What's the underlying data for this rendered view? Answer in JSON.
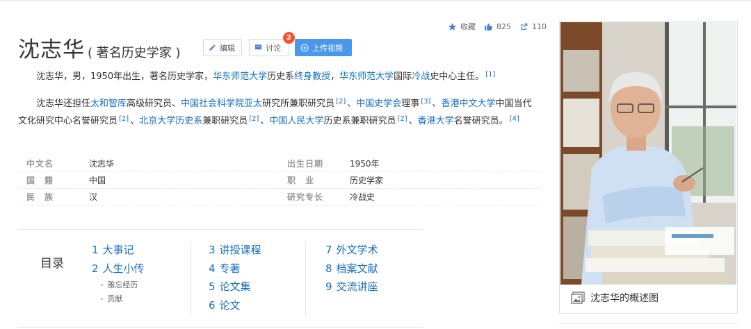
{
  "actions": {
    "favorite_label": "收藏",
    "like_count": "825",
    "share_count": "110"
  },
  "header": {
    "title": "沈志华",
    "subtitle": "( 著名历史学家 )",
    "edit_label": "编辑",
    "discuss_label": "讨论",
    "discuss_badge": "2",
    "upload_label": "上传视频"
  },
  "summary": {
    "p1": {
      "a": "沈志华，男，1950年出生，著名历史学家，",
      "link1": "华东师范大学",
      "b": "历史系",
      "link2": "终身教授",
      "c": "，",
      "link3": "华东师范大学",
      "d": "国际",
      "link4": "冷战",
      "e": "史中心主任。",
      "ref1": "[1]"
    },
    "p2": {
      "a": "沈志华还担任",
      "link1": "太和智库",
      "b": "高级研究员、",
      "link2": "中国社会科学院亚太",
      "c": "研究所兼职研究员",
      "ref1": "[2]",
      "d": "、",
      "link3": "中国史学会",
      "e": "理事",
      "ref2": "[3]",
      "f": "、",
      "link4": "香港中文大学",
      "g": "中国当代文化研究中心名誉研究员",
      "ref3": "[2]",
      "h": "、",
      "link5": "北京大学历史系",
      "i": "兼职研究员",
      "ref4": "[2]",
      "j": "、",
      "link6": "中国人民大学",
      "k": "历史系兼职研究员",
      "ref5": "[2]",
      "l": "、",
      "link7": "香港大学",
      "m": "名誉研究员。",
      "ref6": "[4]"
    }
  },
  "info": {
    "rows": [
      {
        "l1": "中文名",
        "v1": "沈志华",
        "l2": "出生日期",
        "v2": "1950年"
      },
      {
        "l1": "国　籍",
        "v1": "中国",
        "l2": "职　业",
        "v2": "历史学家"
      },
      {
        "l1": "民　族",
        "v1": "汉",
        "l2": "研究专长",
        "v2": "冷战史"
      }
    ]
  },
  "toc": {
    "title": "目录",
    "col1": [
      {
        "num": "1",
        "label": "大事记"
      },
      {
        "num": "2",
        "label": "人生小传"
      }
    ],
    "col1_sub": [
      "雅忘经历",
      "贡献"
    ],
    "col2": [
      {
        "num": "3",
        "label": "讲授课程"
      },
      {
        "num": "4",
        "label": "专著"
      },
      {
        "num": "5",
        "label": "论文集"
      },
      {
        "num": "6",
        "label": "论文"
      }
    ],
    "col3": [
      {
        "num": "7",
        "label": "外文学术"
      },
      {
        "num": "8",
        "label": "档案文献"
      },
      {
        "num": "9",
        "label": "交流讲座"
      }
    ]
  },
  "photo": {
    "caption": "沈志华的概述图"
  },
  "colors": {
    "link": "#136ec2",
    "upload_button": "#4a98ea",
    "badge": "#f25434"
  }
}
